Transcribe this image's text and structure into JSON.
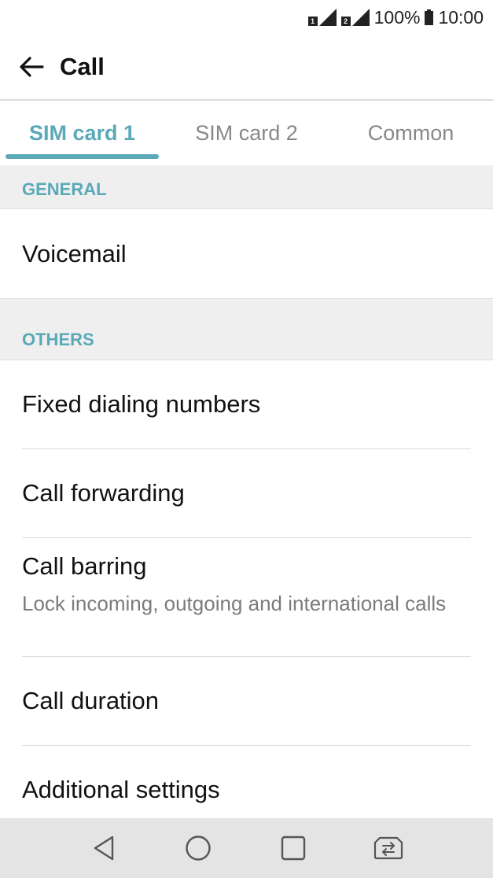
{
  "status_bar": {
    "sim1_badge": "1",
    "sim2_badge": "2",
    "battery_percent": "100%",
    "time": "10:00"
  },
  "header": {
    "title": "Call",
    "back_icon": "back-arrow-icon"
  },
  "tabs": [
    {
      "label": "SIM card 1",
      "active": true
    },
    {
      "label": "SIM card 2",
      "active": false
    },
    {
      "label": "Common",
      "active": false
    }
  ],
  "sections": {
    "general": {
      "header": "GENERAL",
      "items": [
        {
          "title": "Voicemail"
        }
      ]
    },
    "others": {
      "header": "OTHERS",
      "items": [
        {
          "title": "Fixed dialing numbers"
        },
        {
          "title": "Call forwarding"
        },
        {
          "title": "Call barring",
          "summary": "Lock incoming, outgoing and international calls"
        },
        {
          "title": "Call duration"
        },
        {
          "title": "Additional settings"
        }
      ]
    }
  },
  "nav_bar": {
    "icons": [
      "back-triangle-icon",
      "home-circle-icon",
      "recents-square-icon",
      "sim-switch-icon"
    ]
  },
  "colors": {
    "accent": "#5aa9b8",
    "section_bg": "#efefef",
    "nav_bg": "#e4e4e4"
  }
}
